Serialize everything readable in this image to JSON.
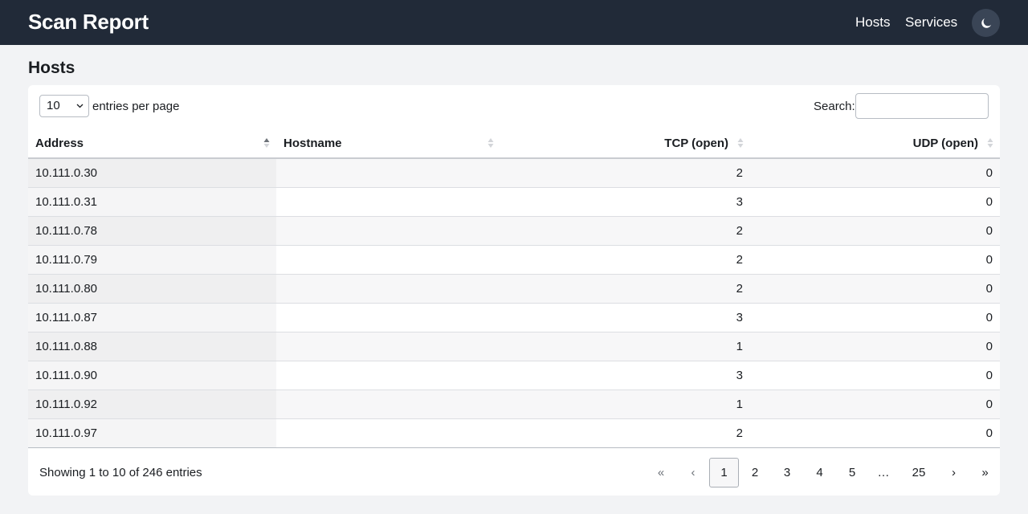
{
  "navbar": {
    "brand": "Scan Report",
    "links": [
      "Hosts",
      "Services"
    ],
    "theme_icon": "moon-icon"
  },
  "page": {
    "title": "Hosts"
  },
  "controls": {
    "page_length": "10",
    "page_length_label": "entries per page",
    "search_label": "Search:",
    "search_value": ""
  },
  "table": {
    "columns": [
      "Address",
      "Hostname",
      "TCP (open)",
      "UDP (open)"
    ],
    "sorted_column": "Address",
    "sort_direction": "ascending",
    "rows": [
      [
        "10.111.0.30",
        "",
        "2",
        "0"
      ],
      [
        "10.111.0.31",
        "",
        "3",
        "0"
      ],
      [
        "10.111.0.78",
        "",
        "2",
        "0"
      ],
      [
        "10.111.0.79",
        "",
        "2",
        "0"
      ],
      [
        "10.111.0.80",
        "",
        "2",
        "0"
      ],
      [
        "10.111.0.87",
        "",
        "3",
        "0"
      ],
      [
        "10.111.0.88",
        "",
        "1",
        "0"
      ],
      [
        "10.111.0.90",
        "",
        "3",
        "0"
      ],
      [
        "10.111.0.92",
        "",
        "1",
        "0"
      ],
      [
        "10.111.0.97",
        "",
        "2",
        "0"
      ]
    ]
  },
  "footer": {
    "info": "Showing 1 to 10 of 246 entries",
    "pagination": {
      "first": "«",
      "prev": "‹",
      "pages": [
        "1",
        "2",
        "3",
        "4",
        "5",
        "…",
        "25"
      ],
      "current": "1",
      "next": "›",
      "last": "»"
    }
  },
  "colors": {
    "navbar_bg": "#212a38",
    "page_bg": "#f2f3f5",
    "toggle_bg": "#3a4556"
  }
}
